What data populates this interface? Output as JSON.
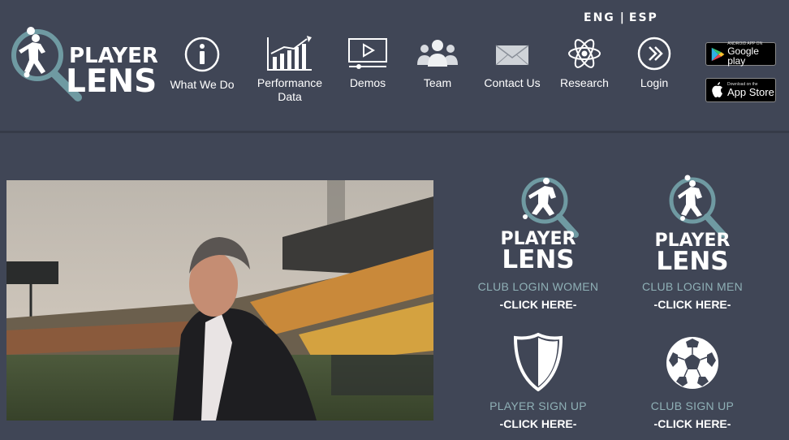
{
  "language": {
    "eng": "ENG",
    "separator": "|",
    "esp": "ESP"
  },
  "brand": {
    "line1": "PLAYER",
    "line2": "LENS"
  },
  "nav": [
    {
      "label": "What We Do",
      "icon": "info-icon"
    },
    {
      "label": "Performance Data",
      "icon": "bar-chart-icon"
    },
    {
      "label": "Demos",
      "icon": "video-play-icon"
    },
    {
      "label": "Team",
      "icon": "team-icon"
    },
    {
      "label": "Contact Us",
      "icon": "envelope-icon"
    },
    {
      "label": "Research",
      "icon": "atom-icon"
    },
    {
      "label": "Login",
      "icon": "chevron-right-circle-icon"
    }
  ],
  "stores": {
    "google": {
      "small": "Android App On",
      "big": "Google play"
    },
    "apple": {
      "small": "Download on the",
      "big": "App Store"
    }
  },
  "tiles": [
    {
      "title": "CLUB LOGIN WOMEN",
      "cta": "-CLICK HERE-",
      "icon": "player-lens-logo-icon"
    },
    {
      "title": "CLUB LOGIN MEN",
      "cta": "-CLICK HERE-",
      "icon": "player-lens-logo-icon"
    },
    {
      "title": "PLAYER SIGN UP",
      "cta": "-CLICK HERE-",
      "icon": "shield-icon"
    },
    {
      "title": "CLUB SIGN UP",
      "cta": "-CLICK HERE-",
      "icon": "soccer-ball-icon"
    }
  ],
  "colors": {
    "background": "#404656",
    "accent_teal": "#6f9aa2",
    "tile_title": "#8fb0b6",
    "text": "#ffffff"
  }
}
